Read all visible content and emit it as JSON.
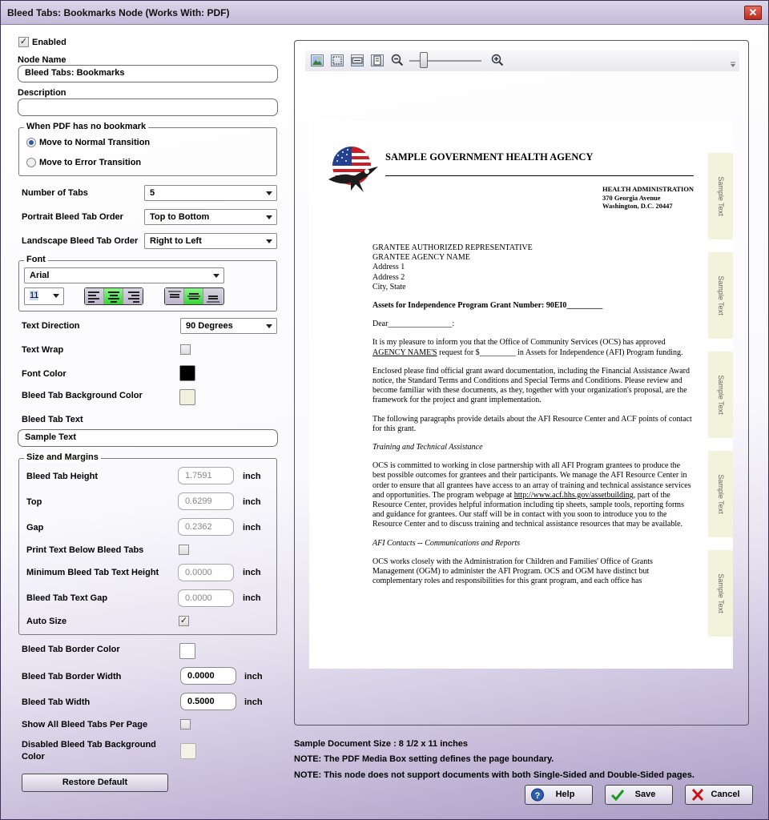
{
  "window": {
    "title": "Bleed Tabs: Bookmarks Node (Works With: PDF)",
    "close_glyph": "✕"
  },
  "general": {
    "enabled_label": "Enabled",
    "enabled": true,
    "node_name_label": "Node Name",
    "node_name_value": "Bleed Tabs: Bookmarks",
    "description_label": "Description",
    "description_value": ""
  },
  "no_bookmark": {
    "title": "When PDF has no bookmark",
    "options": [
      "Move to Normal Transition",
      "Move to Error Transition"
    ],
    "selected": 0
  },
  "tabs": {
    "number_label": "Number of Tabs",
    "number_value": "5",
    "portrait_label": "Portrait Bleed Tab Order",
    "portrait_value": "Top to Bottom",
    "landscape_label": "Landscape Bleed Tab Order",
    "landscape_value": "Right to Left"
  },
  "font": {
    "title": "Font",
    "family": "Arial",
    "size": "11",
    "h_align_selected": "center",
    "v_align_selected": "middle"
  },
  "text": {
    "direction_label": "Text Direction",
    "direction_value": "90 Degrees",
    "wrap_label": "Text Wrap",
    "wrap": false,
    "font_color_label": "Font Color",
    "font_color": "#000000",
    "bg_color_label": "Bleed Tab Background Color",
    "bg_color": "#f2f2dc",
    "tab_text_label": "Bleed Tab Text",
    "tab_text_value": "Sample Text"
  },
  "size_margins": {
    "title": "Size and Margins",
    "unit": "inch",
    "height_label": "Bleed Tab Height",
    "height_value": "1.7591",
    "top_label": "Top",
    "top_value": "0.6299",
    "gap_label": "Gap",
    "gap_value": "0.2362",
    "print_below_label": "Print Text Below Bleed Tabs",
    "print_below": false,
    "min_text_height_label": "Minimum Bleed Tab Text Height",
    "min_text_height_value": "0.0000",
    "text_gap_label": "Bleed Tab Text Gap",
    "text_gap_value": "0.0000",
    "auto_size_label": "Auto Size",
    "auto_size": true
  },
  "border": {
    "color_label": "Bleed Tab Border Color",
    "color": "#ffffff",
    "width_label": "Bleed Tab Border Width",
    "width_value": "0.0000",
    "tab_width_label": "Bleed Tab Width",
    "tab_width_value": "0.5000",
    "show_all_label": "Show All Bleed Tabs Per Page",
    "show_all": false,
    "disabled_bg_label_line1": "Disabled Bleed Tab Background",
    "disabled_bg_label_line2": "Color",
    "disabled_bg_color": "#f2f2e6"
  },
  "restore_default_label": "Restore Default",
  "preview": {
    "toolbar_icons": [
      "image-icon",
      "fit-page-icon",
      "fit-width-icon",
      "actual-size-icon",
      "zoom-out-icon",
      "zoom-in-icon"
    ],
    "zoom_level": 0.2,
    "tab_text": "Sample Text",
    "tab_count": 5,
    "document": {
      "agency": "SAMPLE GOVERNMENT HEALTH AGENCY",
      "dept": "HEALTH ADMINISTRATION",
      "street": "370 Georgia Avenue",
      "city": "Washington, D.C. 20447",
      "addr": [
        "GRANTEE AUTHORIZED REPRESENTATIVE",
        "GRANTEE AGENCY NAME",
        "Address 1",
        "Address 2",
        "City, State"
      ],
      "subject": "Assets for Independence Program Grant Number:  90EI0_________",
      "salutation": "Dear________________:",
      "para1_a": "It is my pleasure to inform you that the Office of Community Services (OCS) has approved ",
      "para1_link": "AGENCY NAME'S",
      "para1_b": "  request for $_________ in Assets for Independence (AFI) Program funding.",
      "para2": "Enclosed please find official grant award documentation, including the Financial Assistance Award notice, the Standard Terms and Conditions and Special Terms and Conditions.  Please review and become familiar with these documents, as they, together with your organization's proposal, are the framework for the project and grant implementation.",
      "para3": "The following paragraphs provide details about the AFI Resource Center and ACF points of contact for this grant.",
      "heading1": "Training and Technical Assistance",
      "para4_a": "OCS is committed to working in close partnership with all AFI Program grantees to produce the best possible outcomes for grantees and their participants.  We manage the AFI Resource Center in order to ensure that all grantees have access to an array of training and technical assistance services and opportunities.  The program webpage at ",
      "para4_link": "http://www.acf.hhs.gov/assetbuilding",
      "para4_b": ", part of the Resource Center, provides helpful information including tip sheets, sample tools, reporting forms and guidance for grantees.  Our staff will be in contact with you soon to introduce you to the Resource Center and to discuss training and technical assistance resources that may be available.",
      "heading2": "AFI Contacts -- Communications and Reports",
      "para5": "OCS works closely with the Administration for Children and Families' Office of Grants Management (OGM) to administer the AFI Program.  OCS and OGM have distinct but complementary roles and responsibilities for this grant program, and each office has"
    }
  },
  "notes": {
    "size": "Sample Document Size : 8 1/2 x 11 inches",
    "media_box": "NOTE: The PDF Media Box setting defines the page boundary.",
    "single_double": "NOTE: This node does not support documents with both Single-Sided and Double-Sided pages."
  },
  "buttons": {
    "help": "Help",
    "save": "Save",
    "cancel": "Cancel"
  },
  "colors": {
    "accent_green": "#38d238",
    "cancel_red": "#cc1111",
    "save_green": "#1a9a1a",
    "help_blue": "#2a5db0"
  }
}
